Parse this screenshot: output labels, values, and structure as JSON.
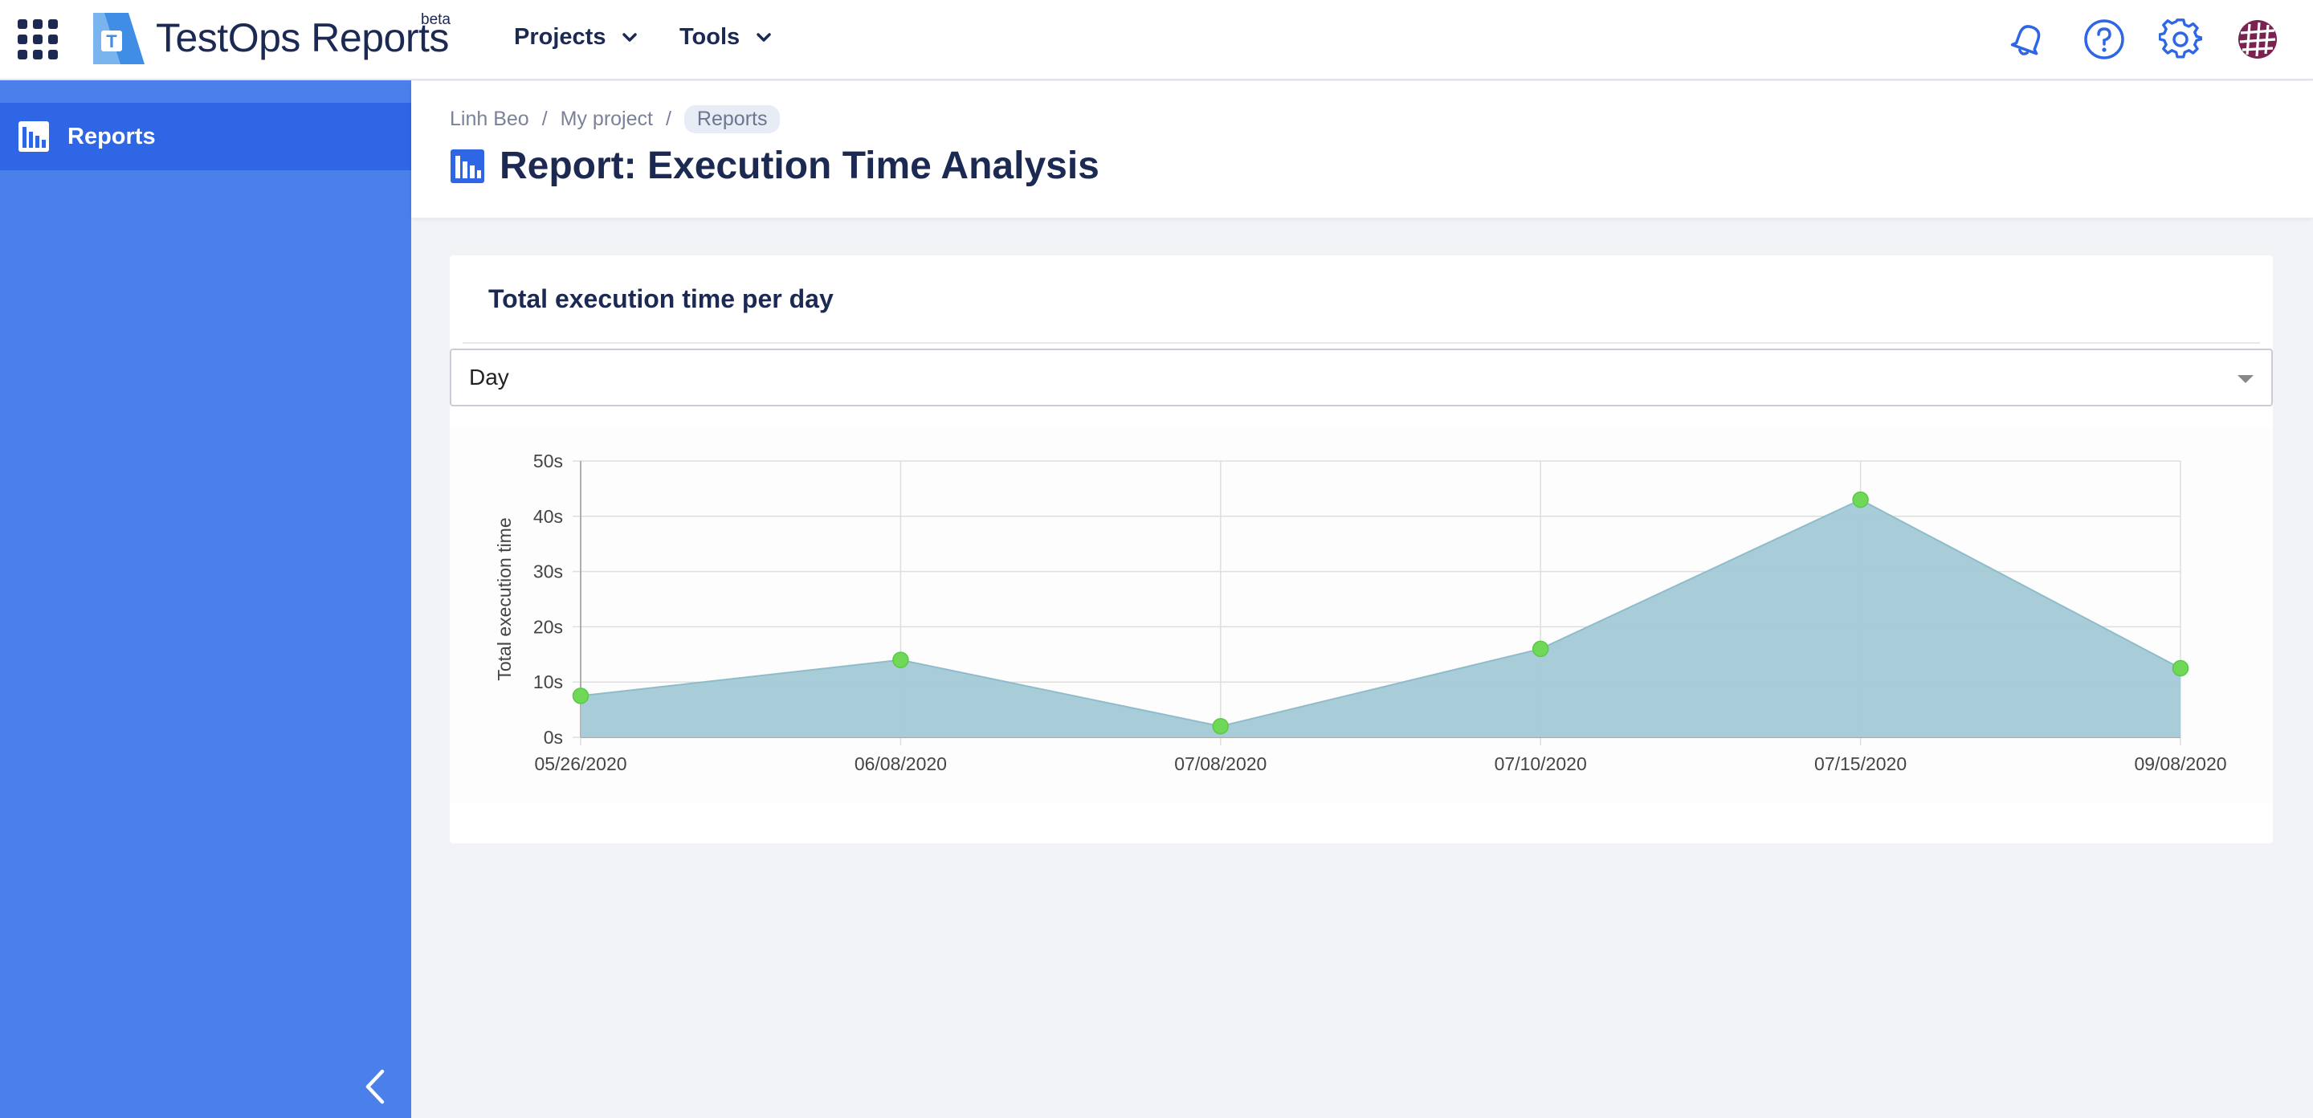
{
  "app": {
    "brand": "TestOps Reports",
    "badge": "beta"
  },
  "nav": {
    "items": [
      {
        "label": "Projects"
      },
      {
        "label": "Tools"
      }
    ]
  },
  "header_icons": [
    "bell-icon",
    "help-icon",
    "gear-icon",
    "avatar"
  ],
  "sidebar": {
    "items": [
      {
        "label": "Reports",
        "icon": "report-icon",
        "active": true
      }
    ]
  },
  "breadcrumb": [
    "Linh Beo",
    "My project",
    "Reports"
  ],
  "page": {
    "title": "Report: Execution Time Analysis"
  },
  "card": {
    "title": "Total execution time per day",
    "select_value": "Day"
  },
  "colors": {
    "accent": "#2f66e6",
    "sidebar": "#4b7fea",
    "area_fill": "#a4cad6",
    "area_line": "#8fbccb",
    "point": "#6fd957"
  },
  "chart_data": {
    "type": "area",
    "title": "",
    "xlabel": "",
    "ylabel": "Total execution time",
    "categories": [
      "05/26/2020",
      "06/08/2020",
      "07/08/2020",
      "07/10/2020",
      "07/15/2020",
      "09/08/2020"
    ],
    "values": [
      7.5,
      14,
      2,
      16,
      43,
      12.5
    ],
    "ylim": [
      0,
      50
    ],
    "yticks": [
      "0s",
      "10s",
      "20s",
      "30s",
      "40s",
      "50s"
    ],
    "y_unit": "s",
    "grid": true,
    "legend": "none"
  }
}
